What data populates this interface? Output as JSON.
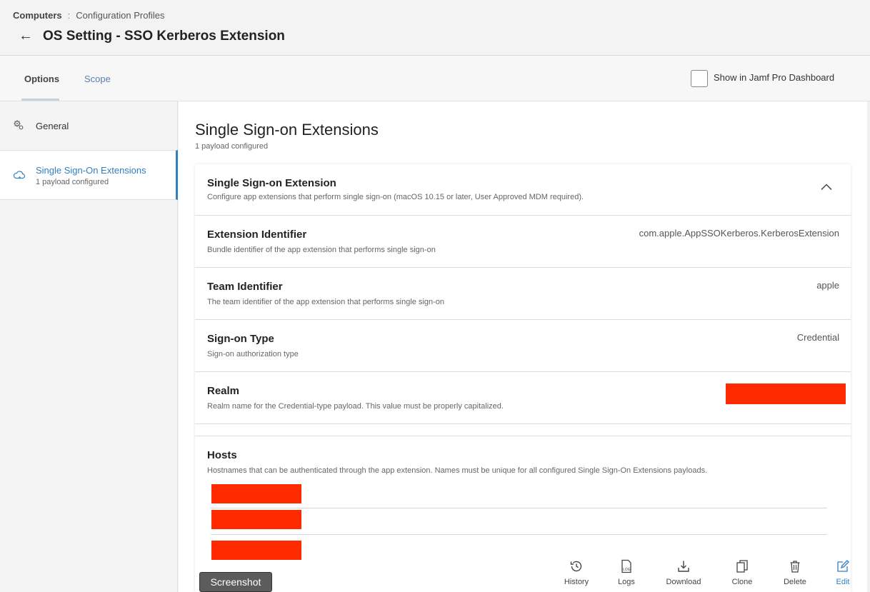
{
  "breadcrumb": {
    "section": "Computers",
    "separator": ":",
    "page": "Configuration Profiles"
  },
  "header": {
    "title": "OS Setting - SSO Kerberos Extension"
  },
  "tabs": [
    {
      "label": "Options"
    },
    {
      "label": "Scope"
    }
  ],
  "dashboard_toggle": {
    "label": "Show in Jamf Pro Dashboard",
    "checked": false
  },
  "sidebar": {
    "items": [
      {
        "label": "General",
        "icon": "gear-icon"
      },
      {
        "label": "Single Sign-On Extensions",
        "sublabel": "1 payload configured",
        "icon": "cloud-icon",
        "selected": true
      }
    ]
  },
  "main": {
    "title": "Single Sign-on Extensions",
    "subtitle": "1 payload configured",
    "card": {
      "title": "Single Sign-on Extension",
      "description": "Configure app extensions that perform single sign-on (macOS 10.15 or later, User Approved MDM required).",
      "fields": [
        {
          "title": "Extension Identifier",
          "description": "Bundle identifier of the app extension that performs single sign-on",
          "value": "com.apple.AppSSOKerberos.KerberosExtension"
        },
        {
          "title": "Team Identifier",
          "description": "The team identifier of the app extension that performs single sign-on",
          "value": "apple"
        },
        {
          "title": "Sign-on Type",
          "description": "Sign-on authorization type",
          "value": "Credential"
        },
        {
          "title": "Realm",
          "description": "Realm name for the Credential-type payload. This value must be properly capitalized.",
          "value": ""
        }
      ],
      "hosts": {
        "title": "Hosts",
        "description": "Hostnames that can be authenticated through the app extension. Names must be unique for all configured Single Sign-On Extensions payloads."
      }
    }
  },
  "toolbar": {
    "history": "History",
    "logs": "Logs",
    "logs_icon_text": "LOG",
    "download": "Download",
    "clone": "Clone",
    "delete": "Delete",
    "edit": "Edit"
  },
  "screenshot_button": "Screenshot",
  "colors": {
    "accent": "#2f7fc1",
    "redaction": "#ff2a00"
  }
}
